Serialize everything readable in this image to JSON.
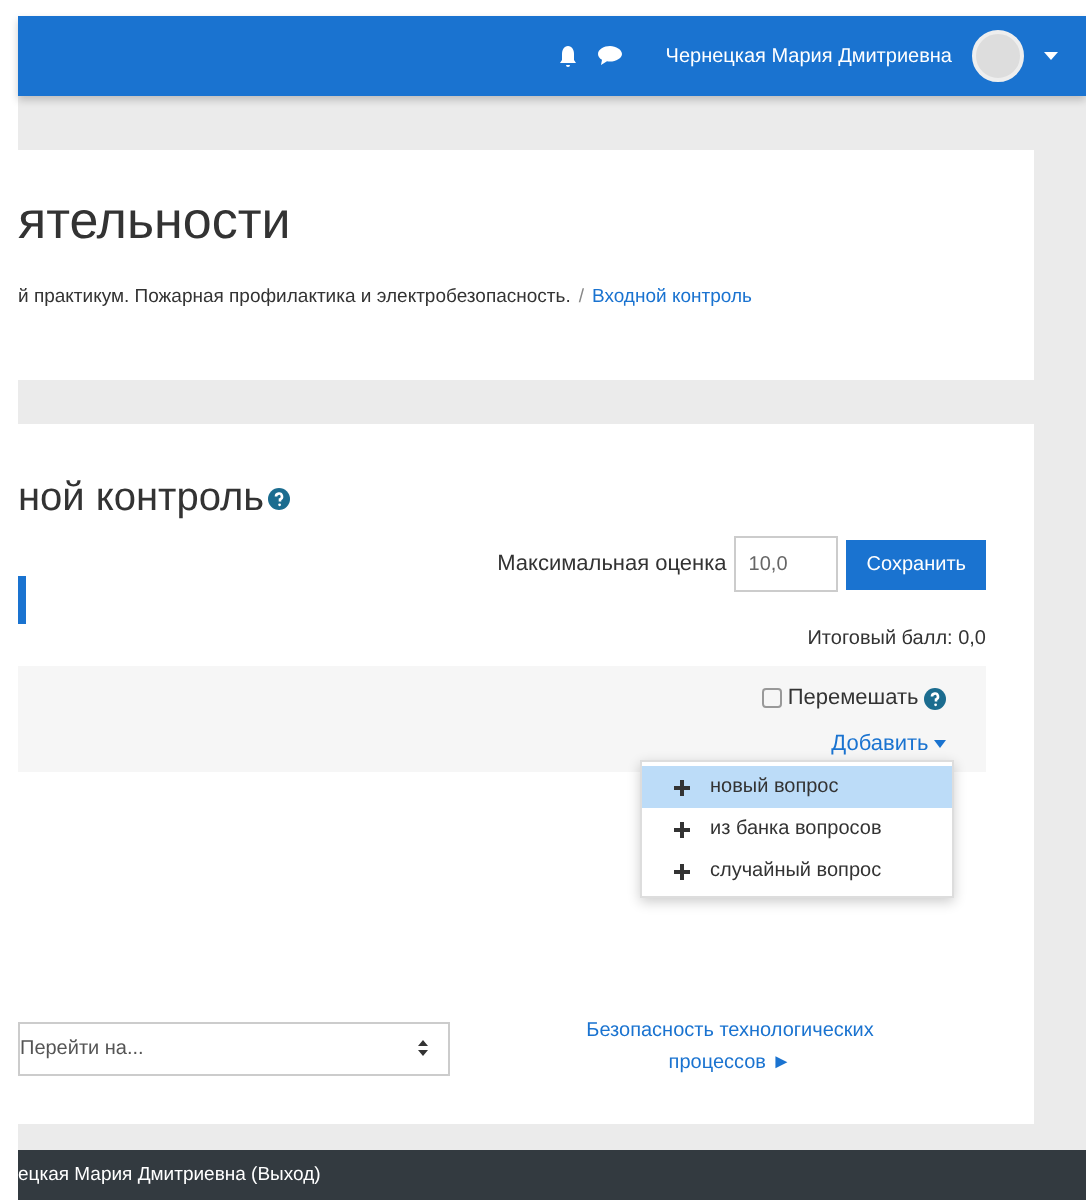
{
  "navbar": {
    "user_name": "Чернецкая Мария Дмитриевна"
  },
  "header": {
    "title": "ятельности",
    "breadcrumb": [
      {
        "label": "й практикум. Пожарная профилактика и электробезопасность.",
        "link": false
      },
      {
        "label": "Входной контроль",
        "link": true
      }
    ],
    "separator": "/"
  },
  "quiz": {
    "title": "ной контроль",
    "max_grade_label": "Максимальная оценка",
    "max_grade_value": "10,0",
    "save_button": "Сохранить",
    "total": "Итоговый балл: 0,0",
    "shuffle": {
      "label": "Перемешать",
      "checked": false
    },
    "add_menu": {
      "label": "Добавить",
      "expanded": true,
      "items": [
        {
          "label": "новый вопрос",
          "selected": true
        },
        {
          "label": "из банка вопросов",
          "selected": false
        },
        {
          "label": "случайный вопрос",
          "selected": false
        }
      ]
    }
  },
  "navigation": {
    "jump_placeholder": "Перейти на...",
    "next_link": "Безопасность технологических процессов",
    "next_arrow": "►"
  },
  "footer": {
    "text": "ецкая Мария Дмитриевна (Выход)"
  }
}
